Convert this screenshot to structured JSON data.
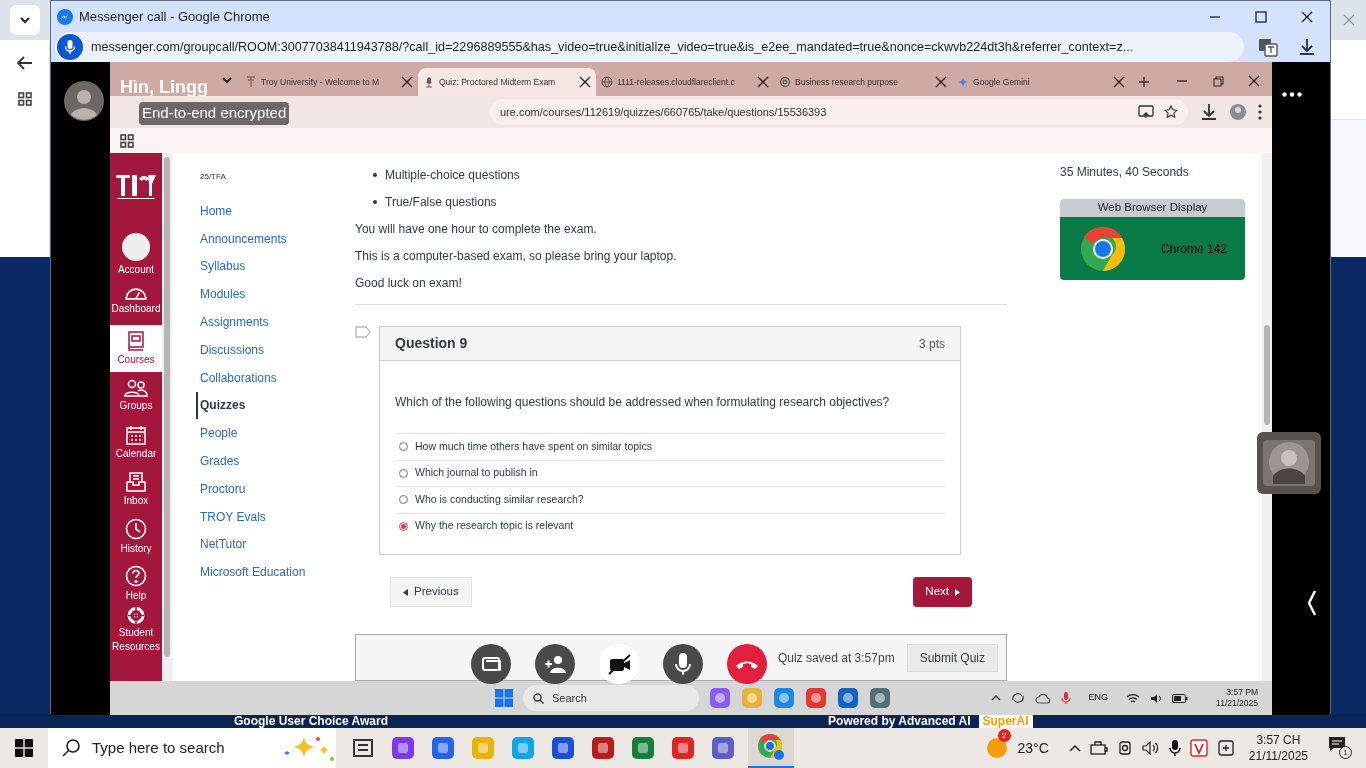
{
  "window": {
    "title": "Messenger call - Google Chrome",
    "url": "messenger.com/groupcall/ROOM:30077038411943788/?call_id=2296889555&has_video=true&initialize_video=true&is_e2ee_mandated=true&nonce=ckwvb224dt3h&referrer_context=z..."
  },
  "call": {
    "name": "Hìn, Lingg",
    "subtitle": "End-to-end encrypted"
  },
  "shared_browser": {
    "tabs": [
      {
        "label": "Troy University - Welcome to M",
        "selected": false
      },
      {
        "label": "Quiz: Proctored Midterm Exam",
        "selected": true
      },
      {
        "label": "1111-releases.cloudflareclient.c",
        "selected": false
      },
      {
        "label": "Business research purpose",
        "selected": false
      },
      {
        "label": "Google Gemini",
        "selected": false
      }
    ],
    "url": "ure.com/courses/112619/quizzes/660765/take/questions/15536393"
  },
  "global_nav": [
    {
      "label": "Account",
      "selected": false
    },
    {
      "label": "Dashboard",
      "selected": false
    },
    {
      "label": "Courses",
      "selected": true
    },
    {
      "label": "Groups",
      "selected": false
    },
    {
      "label": "Calendar",
      "selected": false
    },
    {
      "label": "Inbox",
      "selected": false
    },
    {
      "label": "History",
      "selected": false
    },
    {
      "label": "Help",
      "selected": false
    },
    {
      "label": "Student Resources",
      "selected": false
    }
  ],
  "course_nav": {
    "course_code": "25/TFA",
    "items": [
      {
        "label": "Home",
        "selected": false
      },
      {
        "label": "Announcements",
        "selected": false
      },
      {
        "label": "Syllabus",
        "selected": false
      },
      {
        "label": "Modules",
        "selected": false
      },
      {
        "label": "Assignments",
        "selected": false
      },
      {
        "label": "Discussions",
        "selected": false
      },
      {
        "label": "Collaborations",
        "selected": false
      },
      {
        "label": "Quizzes",
        "selected": true
      },
      {
        "label": "People",
        "selected": false
      },
      {
        "label": "Grades",
        "selected": false
      },
      {
        "label": "Proctoru",
        "selected": false
      },
      {
        "label": "TROY Evals",
        "selected": false
      },
      {
        "label": "NetTutor",
        "selected": false
      },
      {
        "label": "Microsoft Education",
        "selected": false
      }
    ]
  },
  "instructions": {
    "bullets": [
      "Multiple-choice questions",
      "True/False questions"
    ],
    "paragraphs": [
      "You will have one hour to complete the exam.",
      "This is a computer-based exam, so please bring your laptop.",
      "Good luck on exam!"
    ]
  },
  "question": {
    "title": "Question 9",
    "points": "3 pts",
    "text": "Which of the following questions should be addressed when formulating research objectives?",
    "answers": [
      {
        "label": "How much time others have spent on similar topics",
        "selected": false
      },
      {
        "label": "Which journal to publish in",
        "selected": false
      },
      {
        "label": "Who is conducting similar research?",
        "selected": false
      },
      {
        "label": "Why the research topic is relevant",
        "selected": true
      }
    ]
  },
  "navigation": {
    "previous": "Previous",
    "next": "Next"
  },
  "submit_bar": {
    "status": "Quiz saved at 3:57pm",
    "submit": "Submit Quiz"
  },
  "sidebar": {
    "time_remaining": "35 Minutes, 40 Seconds",
    "browser_heading": "Web Browser Display",
    "browser_name": "Chrome 142"
  },
  "shared_taskbar": {
    "search": "Search",
    "language": "ENG",
    "time": "3:57 PM",
    "date": "11/21/2025"
  },
  "background_banners": [
    "Google User Choice Award",
    "Powered by Advanced AI",
    "SuperAI"
  ],
  "taskbar": {
    "search_placeholder": "Type here to search",
    "weather_badge": "2",
    "temperature": "23°C",
    "time": "3:57 CH",
    "date": "21/11/2025",
    "notification_count": "1"
  }
}
